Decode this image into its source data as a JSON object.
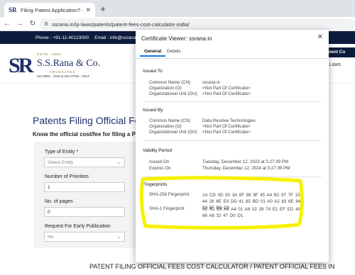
{
  "browser": {
    "tab_title": "Filing Patent Application? Calcula",
    "tab_favicon": "SR",
    "tab_close": "✕",
    "new_tab": "+",
    "url": "ssrana.in/ip-laws/patents/patent-fees-cost-calculator-india/",
    "back": "←",
    "forward": "→",
    "reload": "↻"
  },
  "site": {
    "phone": "Phone : +91-11-40123000",
    "email": "Email : info@ssrana.co",
    "logo": {
      "mark": "SR",
      "estd": "ESTD. 1985",
      "name": "S.S.Rana & Co.",
      "assoc": "ADVOCATES",
      "iso": "ISO 9001 : 2015 & ISO 27001 : 2013"
    },
    "patent_button": "Patent Co",
    "menu_text": "e Laws",
    "page_title": "Patents Filing Official Fee in",
    "page_subtitle": "Know the official cost/fee for filing a Paten",
    "form": {
      "entity_label": "Type of Entity *",
      "entity_value": "Select Entity",
      "priorities_label": "Number of Priorities",
      "priorities_value": "1",
      "pages_label": "No. of pages",
      "pages_value": "0",
      "early_pub_label": "Request For Early Publication",
      "early_pub_value": "No"
    },
    "marquee": "PATENT FILING OFFICIAL FEES COST CALCULATOR / PATENT OFFICIAL FEES IN"
  },
  "dialog": {
    "title": "Certificate Viewer: ssrana.in",
    "close": "✕",
    "tabs": [
      "General",
      "Details"
    ],
    "issued_to": {
      "heading": "Issued To",
      "rows": [
        {
          "label": "Common Name (CN)",
          "value": "ssrana.in"
        },
        {
          "label": "Organization (O)",
          "value": "<Not Part Of Certificate>"
        },
        {
          "label": "Organizational Unit (OU)",
          "value": "<Not Part Of Certificate>"
        }
      ]
    },
    "issued_by": {
      "heading": "Issued By",
      "rows": [
        {
          "label": "Common Name (CN)",
          "value": "Data Resolve Technologies"
        },
        {
          "label": "Organization (O)",
          "value": "<Not Part Of Certificate>"
        },
        {
          "label": "Organizational Unit (OU)",
          "value": "<Not Part Of Certificate>"
        }
      ]
    },
    "validity": {
      "heading": "Validity Period",
      "rows": [
        {
          "label": "Issued On",
          "value": "Tuesday, December 12, 2023 at 5:27:39 PM"
        },
        {
          "label": "Expires On",
          "value": "Thursday, December 12, 2024 at 5:27:39 PM"
        }
      ]
    },
    "fingerprints": {
      "heading": "Fingerprints",
      "sha256_label": "SHA-256 Fingerprint",
      "sha256_value": "1A CD 0D 50 3A 8F 89 8F 45 A4 B2 97 7F 15 44 28 6E E9 DD 41 85 BD 01 A0 A2 83 6E 84 83 6F B8 C9",
      "sha1_label": "SHA-1 Fingerprint",
      "sha1_value": "9E A2 E8 A8 A4 01 A8 02 28 74 E1 EF ED 4A 66 A8 32 47 D0 D1"
    },
    "highlight_color": "#f5f200"
  }
}
